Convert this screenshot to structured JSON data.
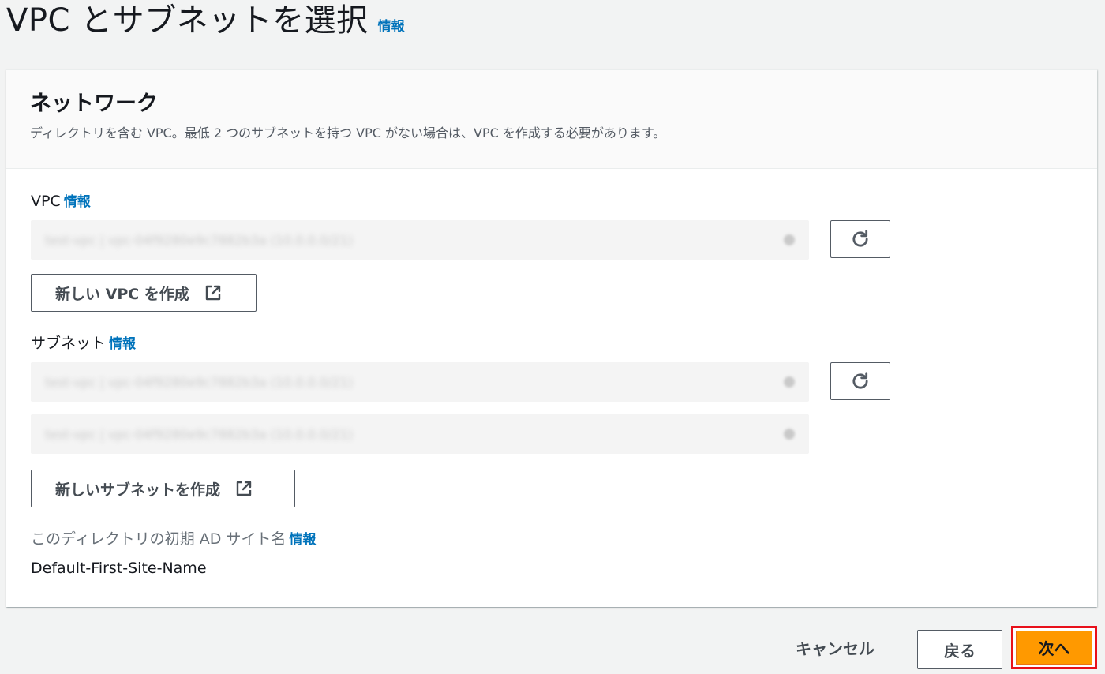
{
  "header": {
    "title": "VPC とサブネットを選択",
    "info": "情報"
  },
  "network": {
    "title": "ネットワーク",
    "description": "ディレクトリを含む VPC。最低 2 つのサブネットを持つ VPC がない場合は、VPC を作成する必要があります。",
    "vpc": {
      "label": "VPC",
      "info": "情報",
      "selected": "test-vpc | vpc-04f9280e9c7882b3a (10.0.0.0/21)",
      "create_label": "新しい VPC を作成"
    },
    "subnets": {
      "label": "サブネット",
      "info": "情報",
      "selected": [
        "test-vpc | vpc-04f9280e9c7882b3a (10.0.0.0/21)",
        "test-vpc | vpc-04f9280e9c7882b3a (10.0.0.0/21)"
      ],
      "create_label": "新しいサブネットを作成"
    },
    "site": {
      "label": "このディレクトリの初期 AD サイト名",
      "info": "情報",
      "value": "Default-First-Site-Name"
    }
  },
  "footer": {
    "cancel": "キャンセル",
    "back": "戻る",
    "next": "次へ"
  },
  "colors": {
    "link": "#0073bb",
    "primary": "#ff9900",
    "highlight": "#e8101a"
  }
}
